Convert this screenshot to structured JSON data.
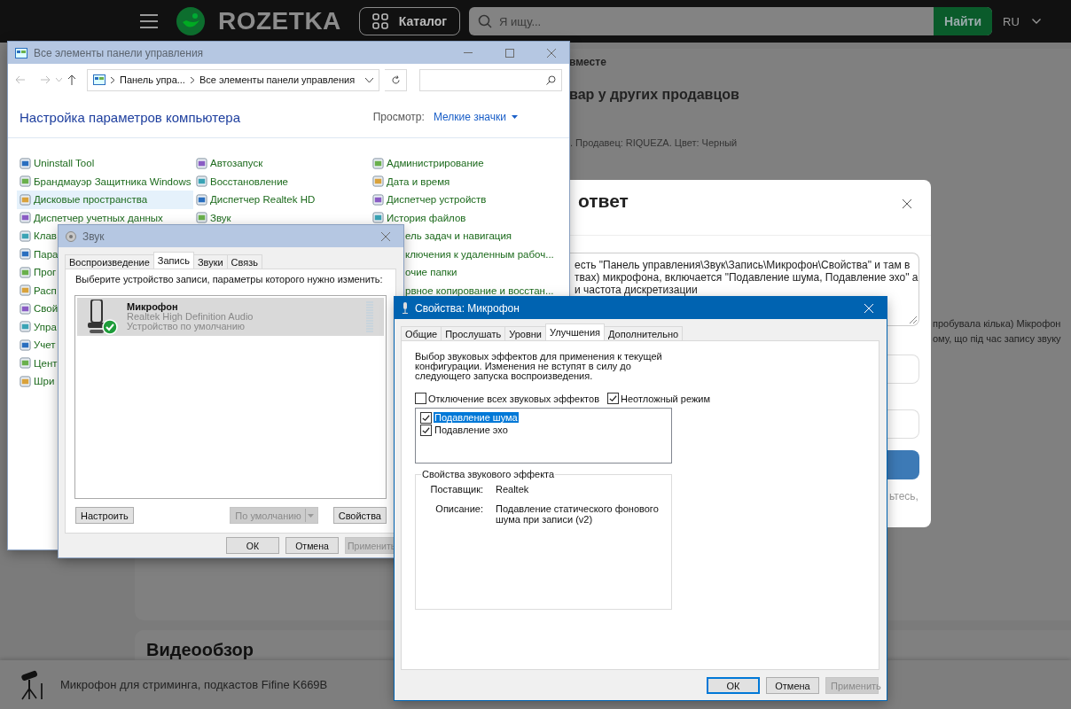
{
  "site_header": {
    "logo_text": "ROZETKA",
    "catalog_button": "Каталог",
    "search": {
      "placeholder": "Я ищу..."
    },
    "search_button": "Найти",
    "language": "RU"
  },
  "page": {
    "tab_fragment": "вместе",
    "section_heading": "вар у других продавцов",
    "offer_details": ". Продавец: RIQUEZA. Цвет: Черный",
    "review_lines": [
      "пробувала кілька) Мікрофон",
      "ому, що під час запису звуку"
    ],
    "video_heading": "Видеообзор",
    "sticky_product": {
      "title": "Микрофон для стриминга, подкастов Fifine K669B"
    }
  },
  "answer_modal": {
    "title": "ответ",
    "answer_lines": [
      "есть \"Панель управления\\Звук\\Запись\\Микрофон\\Свойства\" и там в",
      "твах) микрофона, включается \"Подавление шума, Подавление эхо\" а",
      "и частота дискретизации"
    ],
    "hint": "ьтесь,"
  },
  "control_panel": {
    "title": "Все элементы панели управления",
    "active": false,
    "breadcrumbs": [
      "Панель упра...",
      "Все элементы панели управления"
    ],
    "heading": "Настройка параметров компьютера",
    "view_label": "Просмотр:",
    "view_value": "Мелкие значки",
    "columns": [
      {
        "items": [
          {
            "kind": "item",
            "label": "Uninstall Tool",
            "selected": false
          },
          {
            "kind": "item",
            "label": "Брандмауэр Защитника Windows",
            "selected": false
          },
          {
            "kind": "item",
            "label": "Дисковые пространства",
            "selected": true
          },
          {
            "kind": "item",
            "label": "Диспетчер учетных данных",
            "selected": false
          },
          {
            "kind": "item",
            "label": "Клав",
            "selected": false
          },
          {
            "kind": "item",
            "label": "Пара",
            "selected": false
          },
          {
            "kind": "item",
            "label": "Прог",
            "selected": false
          },
          {
            "kind": "item",
            "label": "Расп",
            "selected": false
          },
          {
            "kind": "item",
            "label": "Свой",
            "selected": false
          },
          {
            "kind": "item",
            "label": "Упра",
            "selected": false
          },
          {
            "kind": "item",
            "label": "Учет",
            "selected": false
          },
          {
            "kind": "item",
            "label": "Цент",
            "selected": false
          },
          {
            "kind": "item",
            "label": "Шри",
            "selected": false
          }
        ]
      },
      {
        "items": [
          {
            "kind": "item",
            "label": "Автозапуск",
            "selected": false
          },
          {
            "kind": "item",
            "label": "Восстановление",
            "selected": false
          },
          {
            "kind": "item",
            "label": "Диспетчер Realtek HD",
            "selected": false
          },
          {
            "kind": "item",
            "label": "Звук",
            "selected": false
          }
        ]
      },
      {
        "items": [
          {
            "kind": "item",
            "label": "Администрирование",
            "selected": false
          },
          {
            "kind": "item",
            "label": "Дата и время",
            "selected": false
          },
          {
            "kind": "item",
            "label": "Диспетчер устройств",
            "selected": false
          },
          {
            "kind": "item",
            "label": "История файлов",
            "selected": false
          },
          {
            "kind": "cut",
            "label": "ель задач и навигация",
            "selected": false
          },
          {
            "kind": "cut",
            "label": "ключения к удаленным рабоч...",
            "selected": false
          },
          {
            "kind": "cut",
            "label": "очие папки",
            "selected": false
          },
          {
            "kind": "cut",
            "label": "рвное копирование и восстан...",
            "selected": false
          }
        ]
      }
    ]
  },
  "sound_dialog": {
    "title": "Звук",
    "active": false,
    "tabs": [
      {
        "label": "Воспроизведение",
        "selected": false
      },
      {
        "label": "Запись",
        "selected": true
      },
      {
        "label": "Звуки",
        "selected": false
      },
      {
        "label": "Связь",
        "selected": false
      }
    ],
    "instruction": "Выберите устройство записи, параметры которого нужно изменить:",
    "devices": [
      {
        "name": "Микрофон",
        "driver": "Realtek High Definition Audio",
        "status": "Устройство по умолчанию",
        "default": true,
        "selected": true,
        "level": 0
      }
    ],
    "buttons": [
      {
        "label": "Настроить",
        "disabled": false,
        "kind": "plain"
      },
      {
        "label": "По умолчанию",
        "disabled": true,
        "kind": "split"
      },
      {
        "label": "Свойства",
        "disabled": false,
        "kind": "plain"
      }
    ],
    "footer_buttons": [
      {
        "label": "ОК",
        "disabled": false,
        "default": false
      },
      {
        "label": "Отмена",
        "disabled": false,
        "default": false
      },
      {
        "label": "Применить",
        "disabled": true,
        "default": false
      }
    ]
  },
  "properties_dialog": {
    "title": "Свойства: Микрофон",
    "active": true,
    "tabs": [
      {
        "label": "Общие",
        "selected": false
      },
      {
        "label": "Прослушать",
        "selected": false
      },
      {
        "label": "Уровни",
        "selected": false
      },
      {
        "label": "Улучшения",
        "selected": true
      },
      {
        "label": "Дополнительно",
        "selected": false
      }
    ],
    "description": "Выбор звуковых эффектов для применения к текущей конфигурации. Изменения не вступят в силу до следующего запуска воспроизведения.",
    "options": [
      {
        "label": "Отключение всех звуковых эффектов",
        "checked": false
      },
      {
        "label": "Неотложный режим",
        "checked": true
      }
    ],
    "effects": [
      {
        "label": "Подавление шума",
        "checked": true,
        "selected": true
      },
      {
        "label": "Подавление эхо",
        "checked": true,
        "selected": false
      }
    ],
    "effect_group": {
      "title": "Свойства звукового эффекта",
      "fields": [
        {
          "label": "Поставщик:",
          "value": "Realtek"
        },
        {
          "label": "Описание:",
          "value": "Подавление статического фонового шума при записи (v2)"
        }
      ]
    },
    "footer_buttons": [
      {
        "label": "ОК",
        "disabled": false,
        "default": true
      },
      {
        "label": "Отмена",
        "disabled": false,
        "default": false
      },
      {
        "label": "Применить",
        "disabled": true,
        "default": false
      }
    ]
  }
}
